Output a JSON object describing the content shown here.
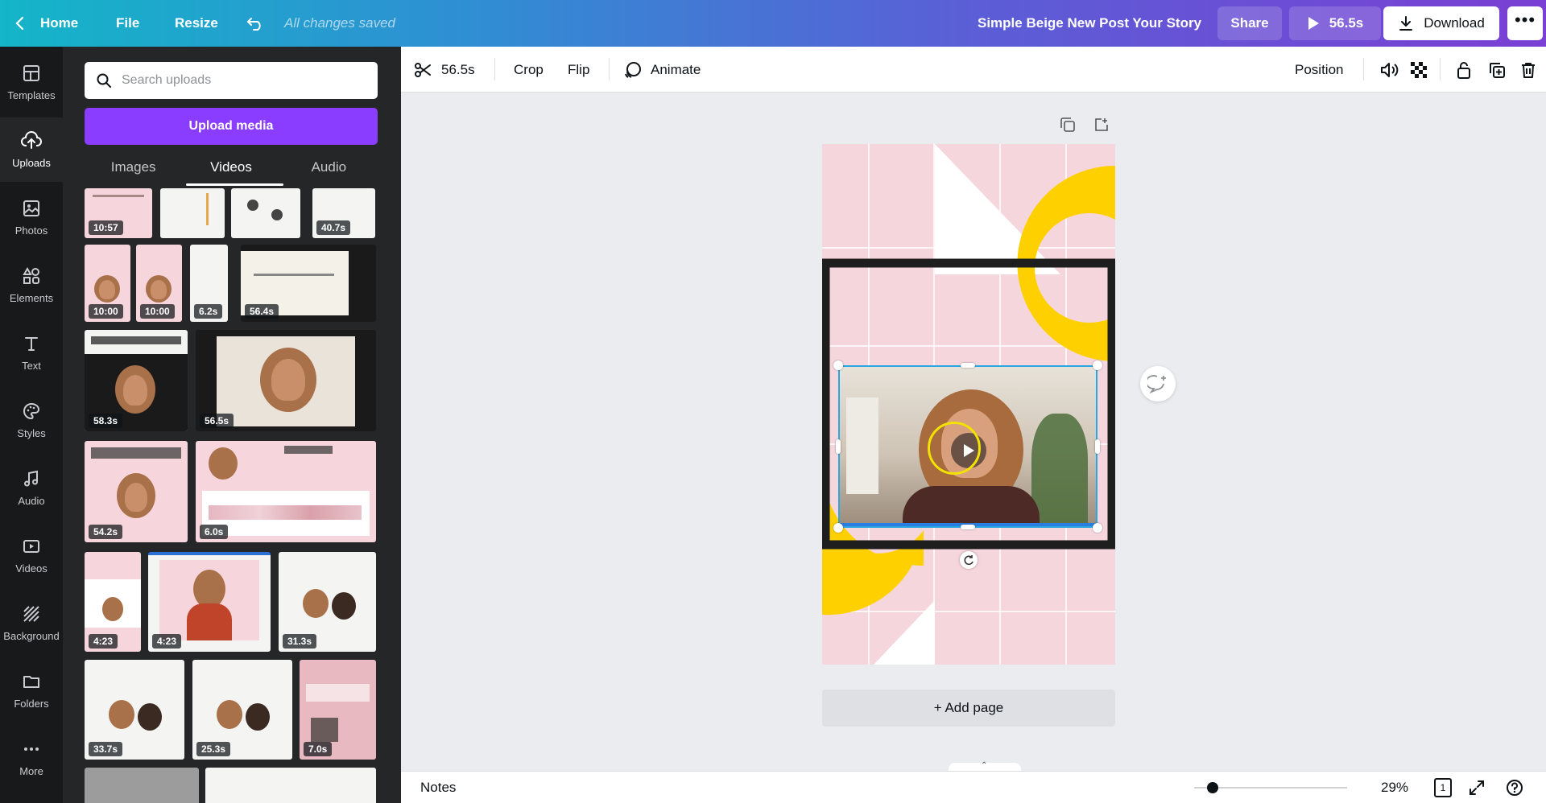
{
  "topbar": {
    "home": "Home",
    "file": "File",
    "resize": "Resize",
    "saved_status": "All changes saved",
    "doc_title": "Simple Beige New Post Your Story",
    "share": "Share",
    "play_duration": "56.5s",
    "download": "Download"
  },
  "rail": {
    "items": [
      {
        "label": "Templates",
        "icon": "templates-icon"
      },
      {
        "label": "Uploads",
        "icon": "upload-cloud-icon"
      },
      {
        "label": "Photos",
        "icon": "photos-icon"
      },
      {
        "label": "Elements",
        "icon": "elements-icon"
      },
      {
        "label": "Text",
        "icon": "text-icon"
      },
      {
        "label": "Styles",
        "icon": "palette-icon"
      },
      {
        "label": "Audio",
        "icon": "music-note-icon"
      },
      {
        "label": "Videos",
        "icon": "video-icon"
      },
      {
        "label": "Background",
        "icon": "background-icon"
      },
      {
        "label": "Folders",
        "icon": "folder-icon"
      },
      {
        "label": "More",
        "icon": "more-dots-icon"
      }
    ]
  },
  "panel": {
    "search_placeholder": "Search uploads",
    "upload_button": "Upload media",
    "tabs": [
      "Images",
      "Videos",
      "Audio"
    ],
    "active_tab": "Videos",
    "durations": {
      "r1": [
        "10:57",
        "40.7s"
      ],
      "r2": [
        "10:00",
        "10:00",
        "6.2s",
        "56.4s"
      ],
      "r3": [
        "58.3s",
        "56.5s"
      ],
      "r4": [
        "54.2s",
        "6.0s"
      ],
      "r5": [
        "4:23",
        "4:23",
        "31.3s"
      ],
      "r6": [
        "33.7s",
        "25.3s",
        "7.0s"
      ]
    }
  },
  "toolbar": {
    "trim_duration": "56.5s",
    "crop": "Crop",
    "flip": "Flip",
    "animate": "Animate",
    "position": "Position"
  },
  "canvas": {
    "add_page": "+ Add page"
  },
  "footer": {
    "notes": "Notes",
    "zoom": "29%",
    "zoom_level": 0.29,
    "page_count": "1"
  },
  "colors": {
    "accent_purple": "#8b3dff",
    "canvas_pink": "#f5d6dd",
    "shape_yellow": "#ffd000",
    "selection_blue": "#2a7de1"
  }
}
